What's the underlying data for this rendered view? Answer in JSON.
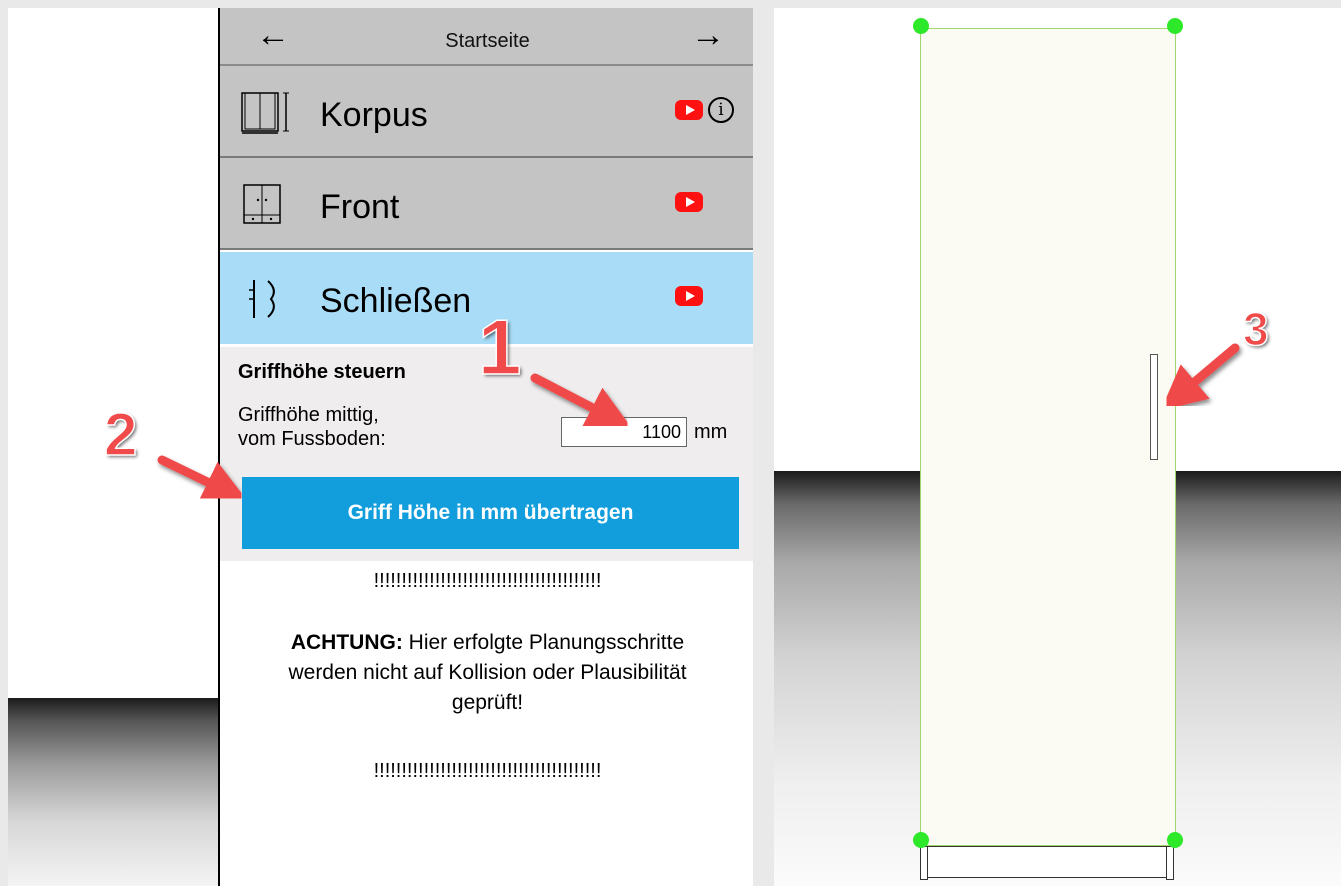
{
  "nav": {
    "prev_arrow": "←",
    "title": "Startseite",
    "next_arrow": "→"
  },
  "sections": [
    {
      "label": "Korpus",
      "icon": "cabinet-body-icon",
      "video": true,
      "info": true,
      "info_symbol": "i"
    },
    {
      "label": "Front",
      "icon": "cabinet-front-icon",
      "video": true,
      "info": false
    },
    {
      "label": "Schließen",
      "icon": "closing-icon",
      "video": true,
      "info": false,
      "active": true
    }
  ],
  "griff": {
    "title": "Griffhöhe steuern",
    "label_line1": "Griffhöhe mittig,",
    "label_line2": "vom Fussboden:",
    "value": "1100",
    "unit": "mm",
    "apply_label": "Griff Höhe in mm übertragen"
  },
  "warning": {
    "separator": "!!!!!!!!!!!!!!!!!!!!!!!!!!!!!!!!!!!!!!!!!",
    "heading": "ACHTUNG:",
    "line1": "Hier erfolgte Planungsschritte",
    "line2": "werden nicht auf Kollision oder Plausibilität",
    "line3": "geprüft!"
  },
  "annotations": {
    "n1": "1",
    "n2": "2",
    "n3": "3"
  },
  "colors": {
    "nav_bg": "#c4c4c4",
    "active_section": "#a9dcf7",
    "button": "#129ddc",
    "youtube": "#ff1111",
    "handle_dots": "#2ee82a",
    "annotation": "#f04a4a"
  }
}
